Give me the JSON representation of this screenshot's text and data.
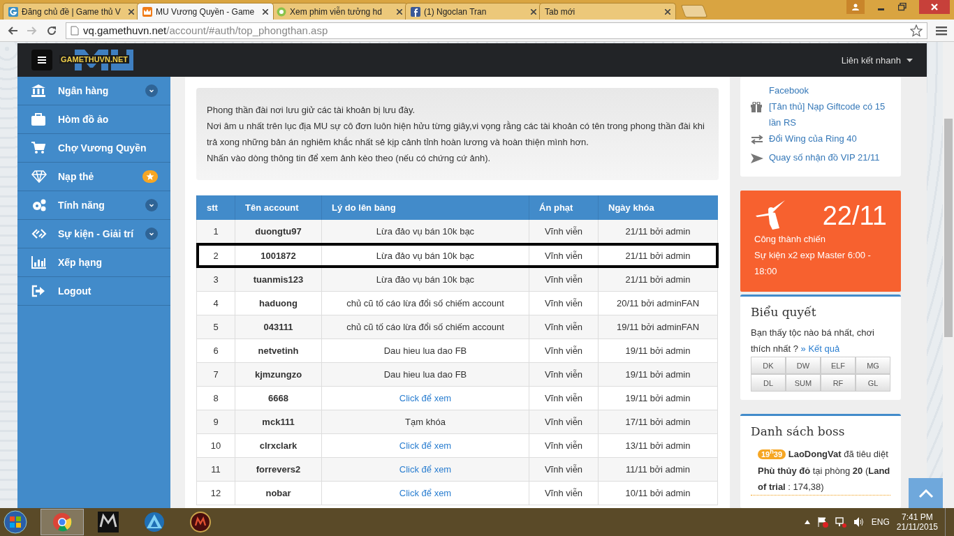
{
  "browser": {
    "tabs": [
      {
        "title": "Đăng chủ đề | Game thủ V",
        "kind": "g",
        "selected": false
      },
      {
        "title": "MU Vương Quyền - Game",
        "kind": "crown",
        "selected": true
      },
      {
        "title": "Xem phim viễn tưởng hd",
        "kind": "film",
        "selected": false
      },
      {
        "title": "(1) Ngoclan Tran",
        "kind": "f",
        "selected": false
      },
      {
        "title": "Tab mới",
        "kind": "blank",
        "selected": false
      }
    ],
    "url_domain": "vq.gamethuvn.net",
    "url_path": "/account/#auth/top_phongthan.asp"
  },
  "navbar": {
    "logo_text": "GAMETHUVN.NET",
    "quick_links": "Liên kết nhanh"
  },
  "sidebar": {
    "items": [
      {
        "label": "Ngân hàng",
        "kind": "bank",
        "expandable": true,
        "featured": false
      },
      {
        "label": "Hòm đồ ảo",
        "kind": "suitcase",
        "expandable": false,
        "featured": false
      },
      {
        "label": "Chợ Vương Quyền",
        "kind": "cart",
        "expandable": false,
        "featured": false
      },
      {
        "label": "Nạp thẻ",
        "kind": "diamond",
        "expandable": false,
        "featured": true
      },
      {
        "label": "Tính năng",
        "kind": "gears",
        "expandable": true,
        "featured": false
      },
      {
        "label": "Sự kiện - Giải trí",
        "kind": "link",
        "expandable": true,
        "featured": false
      },
      {
        "label": "Xếp hạng",
        "kind": "chart",
        "expandable": false,
        "featured": false
      },
      {
        "label": "Logout",
        "kind": "logout",
        "expandable": false,
        "featured": false
      }
    ]
  },
  "intro": [
    "Phong thần đài nơi lưu giử các tài khoản bị lưu đày.",
    "Nơi âm u nhất trên lục địa MU sự cô đơn luôn hiện hửu từng giây,vi vọng rằng các tài khoản có tên trong phong thần đài khi trả xong những bản án nghiêm khắc nhất sẻ kịp cảnh tỉnh hoàn lương và hoàn thiện mình hơn.",
    "Nhấn vào dòng thông tin để xem ảnh kèo theo (nếu có chứng cứ ảnh)."
  ],
  "table": {
    "columns": [
      "stt",
      "Tên account",
      "Lý do lên bảng",
      "Án phạt",
      "Ngày khóa"
    ],
    "rows": [
      {
        "stt": "1",
        "account": "duongtu97",
        "reason": "Lừa đảo vụ bán 10k bạc",
        "kind": "text",
        "penalty": "Vĩnh viễn",
        "date": "21/11 bởi admin",
        "highlighted": false
      },
      {
        "stt": "2",
        "account": "1001872",
        "reason": "Lừa đảo vụ bán 10k bạc",
        "kind": "text",
        "penalty": "Vĩnh viễn",
        "date": "21/11 bởi admin",
        "highlighted": true
      },
      {
        "stt": "3",
        "account": "tuanmis123",
        "reason": "Lừa đảo vụ bán 10k bạc",
        "kind": "text",
        "penalty": "Vĩnh viễn",
        "date": "21/11 bởi admin",
        "highlighted": false
      },
      {
        "stt": "4",
        "account": "haduong",
        "reason": "chủ cũ tố cáo lừa đổi số chiếm account",
        "kind": "text",
        "penalty": "Vĩnh viễn",
        "date": "20/11 bởi adminFAN",
        "highlighted": false
      },
      {
        "stt": "5",
        "account": "043111",
        "reason": "chủ cũ tố cáo lừa đổi số chiếm account",
        "kind": "text",
        "penalty": "Vĩnh viễn",
        "date": "19/11 bởi adminFAN",
        "highlighted": false
      },
      {
        "stt": "6",
        "account": "netvetinh",
        "reason": "Dau hieu lua dao FB",
        "kind": "text",
        "penalty": "Vĩnh viễn",
        "date": "19/11 bởi admin",
        "highlighted": false
      },
      {
        "stt": "7",
        "account": "kjmzungzo",
        "reason": "Dau hieu lua dao FB",
        "kind": "text",
        "penalty": "Vĩnh viễn",
        "date": "19/11 bởi admin",
        "highlighted": false
      },
      {
        "stt": "8",
        "account": "6668",
        "reason": "Click để xem",
        "kind": "link",
        "penalty": "Vĩnh viễn",
        "date": "19/11 bởi admin",
        "highlighted": false
      },
      {
        "stt": "9",
        "account": "mck111",
        "reason": "Tạm khóa",
        "kind": "text",
        "penalty": "Vĩnh viễn",
        "date": "17/11 bởi admin",
        "highlighted": false
      },
      {
        "stt": "10",
        "account": "clrxclark",
        "reason": "Click để xem",
        "kind": "link",
        "penalty": "Vĩnh viễn",
        "date": "13/11 bởi admin",
        "highlighted": false
      },
      {
        "stt": "11",
        "account": "forrevers2",
        "reason": "Click để xem",
        "kind": "link",
        "penalty": "Vĩnh viễn",
        "date": "11/11 bởi admin",
        "highlighted": false
      },
      {
        "stt": "12",
        "account": "nobar",
        "reason": "Click để xem",
        "kind": "link",
        "penalty": "Vĩnh viễn",
        "date": "10/11 bởi admin",
        "highlighted": false
      }
    ]
  },
  "news": [
    {
      "kind": "blank",
      "text": "Facebook"
    },
    {
      "kind": "gift",
      "text": "[Tân thủ] Nạp Giftcode có 15 lần RS"
    },
    {
      "kind": "exchange",
      "text": "Đổi Wing của Ring 40"
    },
    {
      "kind": "send",
      "text": "Quay số nhận đồ VIP 21/11"
    }
  ],
  "event": {
    "date": "22/11",
    "title": "Công thành chiến",
    "detail": "Sự kiện x2 exp Master 6:00 - 18:00"
  },
  "poll": {
    "title": "Biểu quyết",
    "question": "Bạn thấy tộc nào bá nhất, chơi thích nhất ?",
    "result_link": "» Kết quả",
    "options": [
      "DK",
      "DW",
      "ELF",
      "MG",
      "DL",
      "SUM",
      "RF",
      "GL"
    ]
  },
  "boss": {
    "title": "Danh sách boss",
    "entries": [
      {
        "time": "19$^{h}$39",
        "text": "**LaoDongVat** đã tiêu diệt **Phù thủy đỏ** tại phòng **20** (**Land of trial** : 174,38)"
      }
    ]
  },
  "taskbar": {
    "apps": [
      {
        "kind": "chrome",
        "selected": true
      },
      {
        "kind": "mu",
        "selected": false
      },
      {
        "kind": "triangle",
        "selected": false
      },
      {
        "kind": "mu2",
        "selected": false
      }
    ],
    "language": "ENG",
    "time": "7:41 PM",
    "date": "21/11/2015"
  }
}
